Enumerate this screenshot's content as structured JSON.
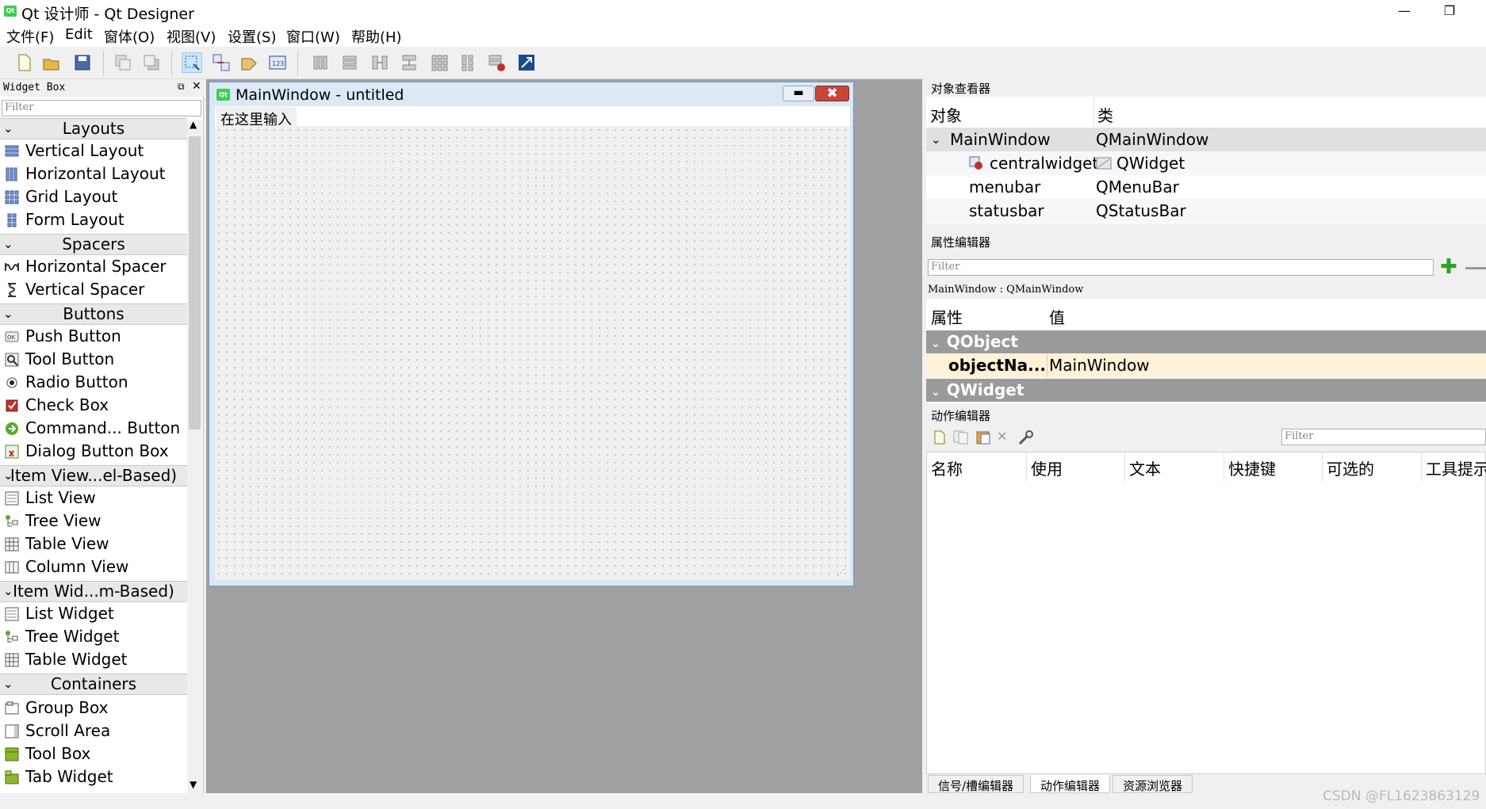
{
  "window": {
    "title": "Qt 设计师 - Qt Designer",
    "min_glyph": "—",
    "max_glyph": "❐"
  },
  "menu": [
    "文件(F)",
    "Edit",
    "窗体(O)",
    "视图(V)",
    "设置(S)",
    "窗口(W)",
    "帮助(H)"
  ],
  "widget_box": {
    "title": "Widget Box",
    "filter_placeholder": "Filter",
    "categories": [
      {
        "label": "Layouts",
        "items": [
          "Vertical Layout",
          "Horizontal Layout",
          "Grid Layout",
          "Form Layout"
        ]
      },
      {
        "label": "Spacers",
        "items": [
          "Horizontal Spacer",
          "Vertical Spacer"
        ]
      },
      {
        "label": "Buttons",
        "items": [
          "Push Button",
          "Tool Button",
          "Radio Button",
          "Check Box",
          "Command... Button",
          "Dialog Button Box"
        ]
      },
      {
        "label": "Item View...el-Based)",
        "items": [
          "List View",
          "Tree View",
          "Table View",
          "Column View"
        ]
      },
      {
        "label": "Item Wid...m-Based)",
        "items": [
          "List Widget",
          "Tree Widget",
          "Table Widget"
        ]
      },
      {
        "label": "Containers",
        "items": [
          "Group Box",
          "Scroll Area",
          "Tool Box",
          "Tab Widget"
        ]
      }
    ]
  },
  "form": {
    "title": "MainWindow - untitled",
    "menu_placeholder": "在这里输入"
  },
  "object_inspector": {
    "title": "对象查看器",
    "headers": [
      "对象",
      "类"
    ],
    "rows": [
      {
        "object": "MainWindow",
        "class": "QMainWindow"
      },
      {
        "object": "centralwidget",
        "class": "QWidget"
      },
      {
        "object": "menubar",
        "class": "QMenuBar"
      },
      {
        "object": "statusbar",
        "class": "QStatusBar"
      }
    ]
  },
  "property_editor": {
    "title": "属性编辑器",
    "filter_placeholder": "Filter",
    "context": "MainWindow : QMainWindow",
    "headers": [
      "属性",
      "值"
    ],
    "groups": [
      "QObject",
      "QWidget"
    ],
    "property": {
      "name": "objectNa...",
      "value": "MainWindow"
    }
  },
  "action_editor": {
    "title": "动作编辑器",
    "filter_placeholder": "Filter",
    "headers": [
      "名称",
      "使用",
      "文本",
      "快捷键",
      "可选的",
      "工具提示"
    ]
  },
  "bottom_tabs": [
    "信号/槽编辑器",
    "动作编辑器",
    "资源浏览器"
  ],
  "watermark": "CSDN @FL1623863129",
  "colors": {
    "accent": "#41cd52",
    "selection": "#cce4f7",
    "group_bg": "#9a9a9a",
    "highlight_row": "#fdf1d9"
  }
}
